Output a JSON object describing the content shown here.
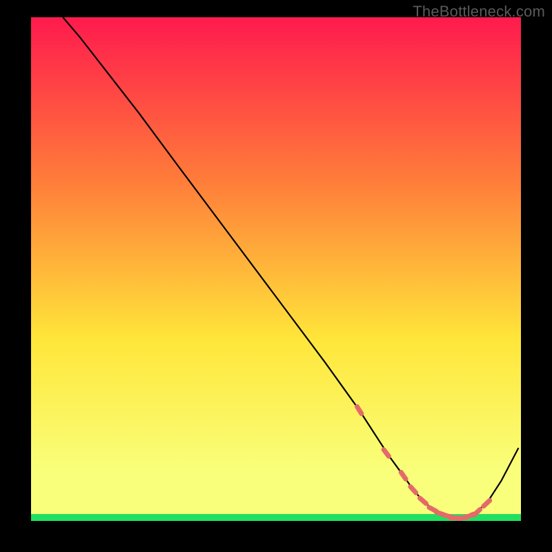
{
  "watermark": "TheBottleneck.com",
  "chart_data": {
    "type": "line",
    "title": "",
    "xlabel": "",
    "ylabel": "",
    "xlim": [
      0,
      100
    ],
    "ylim": [
      0,
      100
    ],
    "legend": false,
    "grid": false,
    "background_gradient": {
      "top": "#ff1a4d",
      "mid1": "#ff7b3a",
      "mid2": "#ffe63a",
      "low": "#f9ff7a",
      "bottom_band": "#20e060"
    },
    "series": [
      {
        "name": "curve",
        "stroke": "#000000",
        "x": [
          6.5,
          10,
          14,
          22,
          30,
          40,
          50,
          60,
          67,
          70,
          73,
          76,
          78,
          80,
          82,
          84,
          86,
          88,
          90,
          93,
          96,
          99.5
        ],
        "y": [
          100.0,
          96.0,
          91.0,
          81.0,
          70.5,
          57.5,
          44.5,
          31.5,
          22.0,
          17.5,
          13.0,
          9.0,
          6.2,
          4.0,
          2.3,
          1.1,
          0.6,
          0.6,
          1.2,
          3.5,
          8.0,
          14.5
        ]
      },
      {
        "name": "bottom-dots",
        "stroke": "#e46a6a",
        "type": "dots",
        "x": [
          67.0,
          72.5,
          76.0,
          78.0,
          80.0,
          82.0,
          83.5,
          85.0,
          86.5,
          88.0,
          89.5,
          91.0,
          93.0
        ],
        "y": [
          22.0,
          13.5,
          9.0,
          6.2,
          4.0,
          2.3,
          1.5,
          1.0,
          0.6,
          0.6,
          1.0,
          1.7,
          3.5
        ]
      }
    ]
  }
}
